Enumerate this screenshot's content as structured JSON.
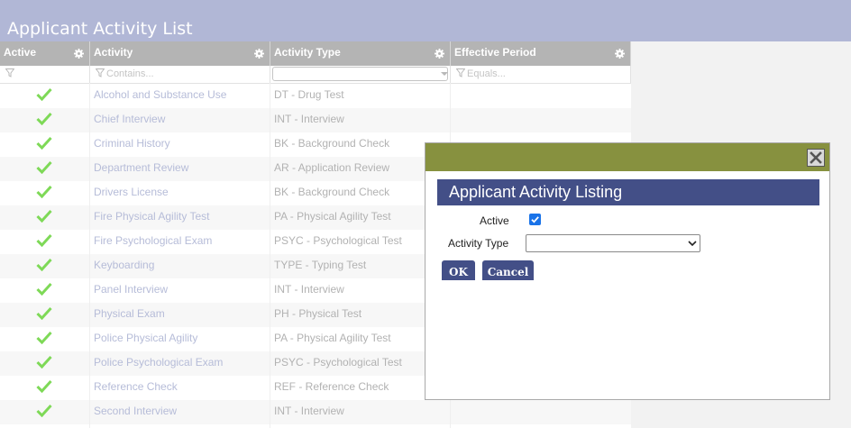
{
  "page": {
    "title": "Applicant Activity List"
  },
  "grid": {
    "columns": [
      "Active",
      "Activity",
      "Activity Type",
      "Effective Period"
    ],
    "filters": {
      "activity_placeholder": "Contains...",
      "period_placeholder": "Equals..."
    },
    "rows": [
      {
        "active": true,
        "activity": "Alcohol and Substance Use",
        "type": "DT - Drug Test"
      },
      {
        "active": true,
        "activity": "Chief Interview",
        "type": "INT - Interview"
      },
      {
        "active": true,
        "activity": "Criminal History",
        "type": "BK - Background Check"
      },
      {
        "active": true,
        "activity": "Department Review",
        "type": "AR - Application Review"
      },
      {
        "active": true,
        "activity": "Drivers License",
        "type": "BK - Background Check"
      },
      {
        "active": true,
        "activity": "Fire Physical Agility Test",
        "type": "PA - Physical Agility Test"
      },
      {
        "active": true,
        "activity": "Fire Psychological Exam",
        "type": "PSYC - Psychological Test"
      },
      {
        "active": true,
        "activity": "Keyboarding",
        "type": "TYPE - Typing Test"
      },
      {
        "active": true,
        "activity": "Panel Interview",
        "type": "INT - Interview"
      },
      {
        "active": true,
        "activity": "Physical Exam",
        "type": "PH - Physical Test"
      },
      {
        "active": true,
        "activity": "Police Physical Agility",
        "type": "PA - Physical Agility Test"
      },
      {
        "active": true,
        "activity": "Police Psychological Exam",
        "type": "PSYC - Psychological Test"
      },
      {
        "active": true,
        "activity": "Reference Check",
        "type": "REF - Reference Check"
      },
      {
        "active": true,
        "activity": "Second Interview",
        "type": "INT - Interview"
      }
    ]
  },
  "dialog": {
    "heading": "Applicant Activity Listing",
    "active_label": "Active",
    "active_checked": true,
    "type_label": "Activity Type",
    "type_value": "",
    "ok_label": "OK",
    "cancel_label": "Cancel"
  },
  "colors": {
    "header": "#b1b7d6",
    "dialog_titlebar": "#87913f",
    "dialog_heading": "#434f87",
    "check": "#7ed957"
  }
}
